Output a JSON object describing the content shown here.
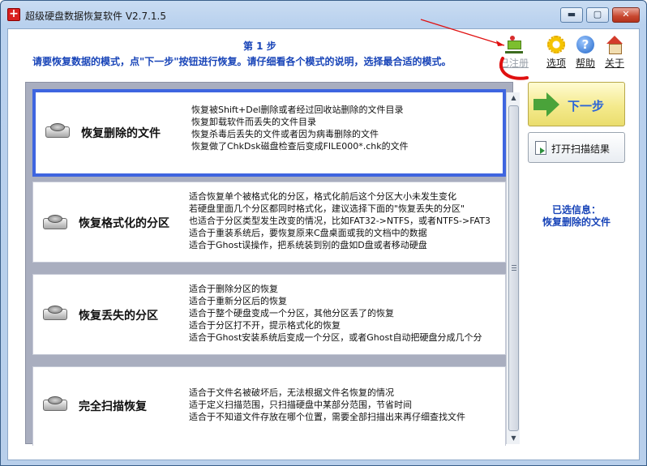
{
  "window": {
    "title": "超级硬盘数据恢复软件 V2.7.1.5",
    "controls": {
      "minimize": "▬",
      "maximize": "▢",
      "close": "✕"
    }
  },
  "header": {
    "step_title": "第 1 步",
    "step_description": "请要恢复数据的模式，点\"下一步\"按钮进行恢复。请仔细看各个模式的说明，选择最合适的模式。"
  },
  "toolbar": {
    "items": [
      {
        "label": "已注册",
        "icon": "cart-icon",
        "enabled": false
      },
      {
        "label": "选项",
        "icon": "gear-icon"
      },
      {
        "label": "帮助",
        "icon": "help-icon",
        "glyph": "?"
      },
      {
        "label": "关于",
        "icon": "home-icon"
      }
    ]
  },
  "modes": [
    {
      "name": "恢复删除的文件",
      "selected": true,
      "icon": "disk-icon",
      "lines": [
        "恢复被Shift+Del删除或者经过回收站删除的文件目录",
        "恢复卸载软件而丢失的文件目录",
        "恢复杀毒后丢失的文件或者因为病毒删除的文件",
        "恢复做了ChkDsk磁盘检查后变成FILE000*.chk的文件"
      ]
    },
    {
      "name": "恢复格式化的分区",
      "selected": false,
      "icon": "disk-icon",
      "lines": [
        "适合恢复单个被格式化的分区，格式化前后这个分区大小未发生变化",
        "若硬盘里面几个分区都同时格式化，建议选择下面的\"恢复丢失的分区\"",
        "也适合于分区类型发生改变的情况，比如FAT32->NTFS，或者NTFS->FAT3",
        "适合于重装系统后，要恢复原来C盘桌面或我的文档中的数据",
        "适合于Ghost误操作，把系统装到别的盘如D盘或者移动硬盘"
      ]
    },
    {
      "name": "恢复丢失的分区",
      "selected": false,
      "icon": "hdd-icon",
      "lines": [
        "适合于删除分区的恢复",
        "适合于重新分区后的恢复",
        "适合于整个硬盘变成一个分区，其他分区丢了的恢复",
        "适合于分区打不开，提示格式化的恢复",
        "适合于Ghost安装系统后变成一个分区，或者Ghost自动把硬盘分成几个分"
      ]
    },
    {
      "name": "完全扫描恢复",
      "selected": false,
      "icon": "hdd-icon",
      "lines": [
        "适合于文件名被破坏后，无法根据文件名恢复的情况",
        "适于定义扫描范围，只扫描硬盘中某部分范围，节省时间",
        "适合于不知道文件存放在哪个位置，需要全部扫描出来再仔细查找文件"
      ]
    }
  ],
  "scrollbar": {
    "up": "▲",
    "down": "▼"
  },
  "actions": {
    "next_label": "下一步",
    "open_scan_label": "打开扫描结果"
  },
  "selection_info": {
    "title": "已选信息：",
    "value": "恢复删除的文件"
  },
  "colors": {
    "accent_blue": "#1844b8",
    "selected_border": "#3e65e0",
    "annotation_red": "#e01010"
  }
}
